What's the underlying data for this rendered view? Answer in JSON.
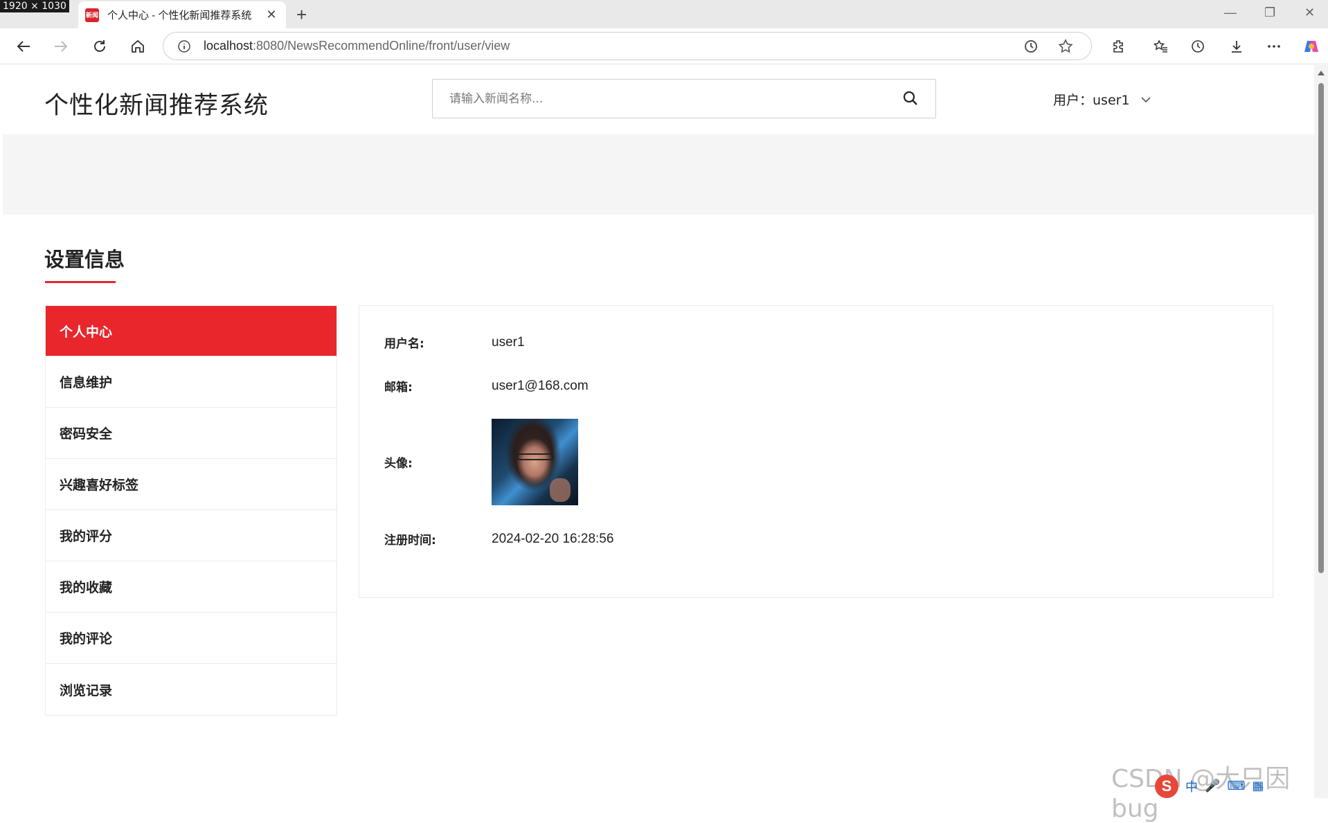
{
  "screen": {
    "resolution_badge": "1920 × 1030"
  },
  "browser": {
    "tab_title": "个人中心 - 个性化新闻推荐系统",
    "tab_favicon_text": "新闻",
    "url_host": "localhost",
    "url_rest": ":8080/NewsRecommendOnline/front/user/view"
  },
  "header": {
    "site_title": "个性化新闻推荐系统",
    "search_placeholder": "请输入新闻名称...",
    "user_label": "用户：user1"
  },
  "section": {
    "title": "设置信息"
  },
  "side_menu": {
    "items": [
      {
        "label": "个人中心",
        "active": true
      },
      {
        "label": "信息维护",
        "active": false
      },
      {
        "label": "密码安全",
        "active": false
      },
      {
        "label": "兴趣喜好标签",
        "active": false
      },
      {
        "label": "我的评分",
        "active": false
      },
      {
        "label": "我的收藏",
        "active": false
      },
      {
        "label": "我的评论",
        "active": false
      },
      {
        "label": "浏览记录",
        "active": false
      }
    ]
  },
  "profile": {
    "username_label": "用户名:",
    "username": "user1",
    "email_label": "邮箱:",
    "email": "user1@168.com",
    "avatar_label": "头像:",
    "register_label": "注册时间:",
    "register_time": "2024-02-20 16:28:56"
  },
  "watermark": "CSDN @大只因bug",
  "tray": {
    "ime": "S",
    "lang": "中"
  },
  "colors": {
    "accent": "#e8262b",
    "banner": "#f5f5f5"
  }
}
